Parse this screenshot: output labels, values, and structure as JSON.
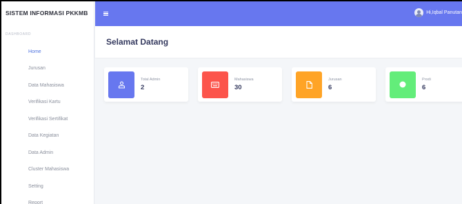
{
  "brand": "SISTEM INFORMASI PKKMB",
  "sidebar": {
    "section_label": "DASHBOARD",
    "items": [
      {
        "label": "Home"
      },
      {
        "label": "Jurusan"
      },
      {
        "label": "Data Mahasiswa"
      },
      {
        "label": "Verifikasi Kartu"
      },
      {
        "label": "Verifikasi Sertifikat"
      },
      {
        "label": "Data Kegiatan"
      },
      {
        "label": "Data Admin"
      },
      {
        "label": "Cluster Mahasiswa"
      },
      {
        "label": "Setting"
      },
      {
        "label": "Report"
      }
    ]
  },
  "topbar": {
    "user_name": "Hi,Iqbal Panutan"
  },
  "header": {
    "title": "Selamat Datang"
  },
  "cards": [
    {
      "label": "Total Admin",
      "value": "2",
      "icon": "user-icon",
      "color": "#6777ef"
    },
    {
      "label": "Mahasiswa",
      "value": "30",
      "icon": "id-card-icon",
      "color": "#fc544b"
    },
    {
      "label": "Jurusan",
      "value": "6",
      "icon": "file-icon",
      "color": "#ffa426"
    },
    {
      "label": "Prodi",
      "value": "6",
      "icon": "circle-icon",
      "color": "#63ed7a"
    }
  ],
  "colors": {
    "accent": "#6777ef",
    "active_nav": "#4e73df"
  }
}
